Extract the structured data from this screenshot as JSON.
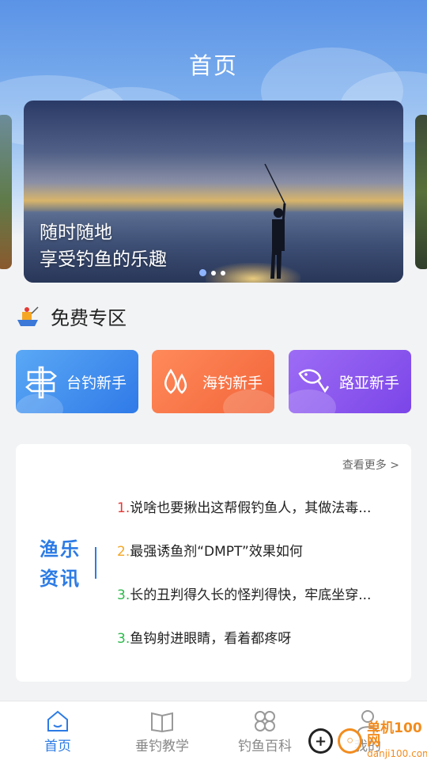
{
  "header": {
    "title": "首页"
  },
  "banner": {
    "line1": "随时随地",
    "line2": "享受钓鱼的乐趣",
    "dots": 3,
    "active_dot": 0
  },
  "free_zone": {
    "title": "免费专区",
    "icon": "fishing-boat-icon",
    "categories": [
      {
        "label": "台钓新手",
        "icon": "signpost-icon",
        "color": "#2f7ae8"
      },
      {
        "label": "海钓新手",
        "icon": "water-drops-icon",
        "color": "#f2653a"
      },
      {
        "label": "路亚新手",
        "icon": "fish-hook-icon",
        "color": "#7b45e8"
      }
    ]
  },
  "news": {
    "label_line1": "渔乐",
    "label_line2": "资讯",
    "more": "查看更多 >",
    "items": [
      {
        "num": "1.",
        "text": "说啥也要揪出这帮假钓鱼人，其做法毒..."
      },
      {
        "num": "2.",
        "text": "最强诱鱼剂“DMPT”效果如何"
      },
      {
        "num": "3.",
        "text": "长的丑判得久长的怪判得快，牢底坐穿..."
      },
      {
        "num": "3.",
        "text": "鱼钩射进眼睛，看着都疼呀"
      }
    ]
  },
  "tabbar": {
    "tabs": [
      {
        "label": "首页",
        "icon": "home-icon",
        "active": true
      },
      {
        "label": "垂钓教学",
        "icon": "book-icon",
        "active": false
      },
      {
        "label": "钓鱼百科",
        "icon": "grid-icon",
        "active": false
      },
      {
        "label": "我的",
        "icon": "user-icon",
        "active": false
      }
    ]
  },
  "watermark": {
    "text1": "单机100网",
    "text2": "danji100.com"
  },
  "colors": {
    "accent": "#2c7be5",
    "header": "#5b93e6"
  }
}
